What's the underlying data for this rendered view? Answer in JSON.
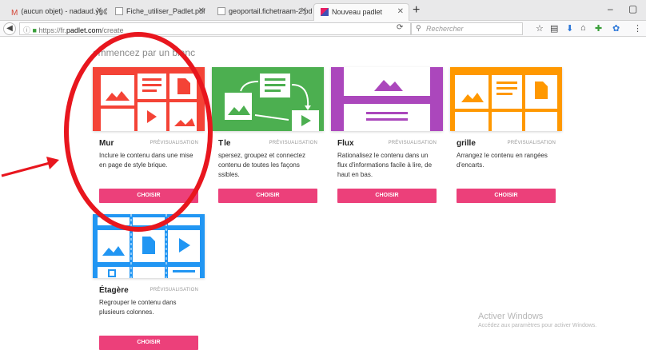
{
  "tabs": [
    {
      "label": "(aucun objet) - nadaud.yg@",
      "favicon": "gmail-icon",
      "active": false
    },
    {
      "label": "Fiche_utiliser_Padlet.pdf",
      "favicon": "pdf-icon",
      "active": false
    },
    {
      "label": "geoportail.fichetraam-2.pdf",
      "favicon": "pdf-icon",
      "active": false
    },
    {
      "label": "Nouveau padlet",
      "favicon": "padlet-icon",
      "active": true
    }
  ],
  "url": {
    "prefix": "https://fr.",
    "host": "padlet.com",
    "path": "/create"
  },
  "search": {
    "placeholder": "Rechercher"
  },
  "page": {
    "heading": "ommencez par un blanc"
  },
  "cards": [
    {
      "name": "Mur",
      "preview": "PRÉVISUALISATION",
      "desc": "Inclure le contenu dans une mise en page de style brique.",
      "button": "CHOISIR",
      "color": "#f44336"
    },
    {
      "name": "T",
      "name_rest": "le",
      "preview": "PRÉVISUALISATION",
      "desc": "spersez, groupez et connectez contenu de toutes les façons ssibles.",
      "button": "CHOISIR",
      "color": "#4caf50"
    },
    {
      "name": "Flux",
      "preview": "PRÉVISUALISATION",
      "desc": "Rationalisez le contenu dans un flux d'informations facile à lire, de haut en bas.",
      "button": "CHOISIR",
      "color": "#ab47bc"
    },
    {
      "name": "grille",
      "preview": "PRÉVISUALISATION",
      "desc": "Arrangez le contenu en rangées d'encarts.",
      "button": "CHOISIR",
      "color": "#ff9800"
    },
    {
      "name": "Étagère",
      "preview": "PRÉVISUALISATION",
      "desc": "Regrouper le contenu dans plusieurs colonnes.",
      "button": "CHOISIR",
      "color": "#2196f3"
    }
  ],
  "watermark": {
    "line1": "Activer Windows",
    "line2": "Accédez aux paramètres pour activer Windows."
  },
  "colors": {
    "button": "#ec407a",
    "annotation": "#e8161e"
  }
}
